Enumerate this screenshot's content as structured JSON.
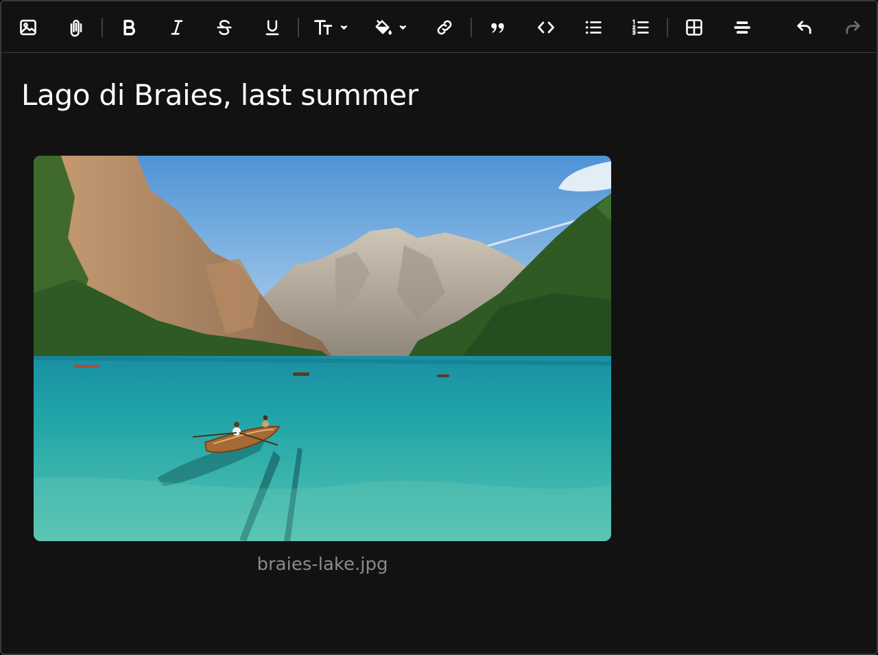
{
  "toolbar": {
    "tools": [
      {
        "name": "image-icon",
        "label": "Insert image"
      },
      {
        "name": "paperclip-icon",
        "label": "Attach file"
      },
      {
        "name": "bold-icon",
        "label": "Bold"
      },
      {
        "name": "italic-icon",
        "label": "Italic"
      },
      {
        "name": "strikethrough-icon",
        "label": "Strikethrough"
      },
      {
        "name": "underline-icon",
        "label": "Underline"
      },
      {
        "name": "text-size-icon",
        "label": "Text size"
      },
      {
        "name": "paint-bucket-icon",
        "label": "Highlight color"
      },
      {
        "name": "link-icon",
        "label": "Link"
      },
      {
        "name": "quote-icon",
        "label": "Quote"
      },
      {
        "name": "code-icon",
        "label": "Code"
      },
      {
        "name": "bullet-list-icon",
        "label": "Bulleted list"
      },
      {
        "name": "numbered-list-icon",
        "label": "Numbered list"
      },
      {
        "name": "table-icon",
        "label": "Table"
      },
      {
        "name": "horizontal-rule-icon",
        "label": "Divider"
      },
      {
        "name": "undo-icon",
        "label": "Undo"
      },
      {
        "name": "redo-icon",
        "label": "Redo"
      }
    ],
    "colors": {
      "icon": "#ffffff",
      "disabled": "#6b6b70",
      "separator": "#3f3f42"
    }
  },
  "document": {
    "title": "Lago di Braies, last summer",
    "image": {
      "caption": "braies-lake.jpg"
    }
  },
  "colors": {
    "background": "#121213",
    "border": "#3a3a3c",
    "text": "#ffffff",
    "caption": "#8a8a8e"
  }
}
